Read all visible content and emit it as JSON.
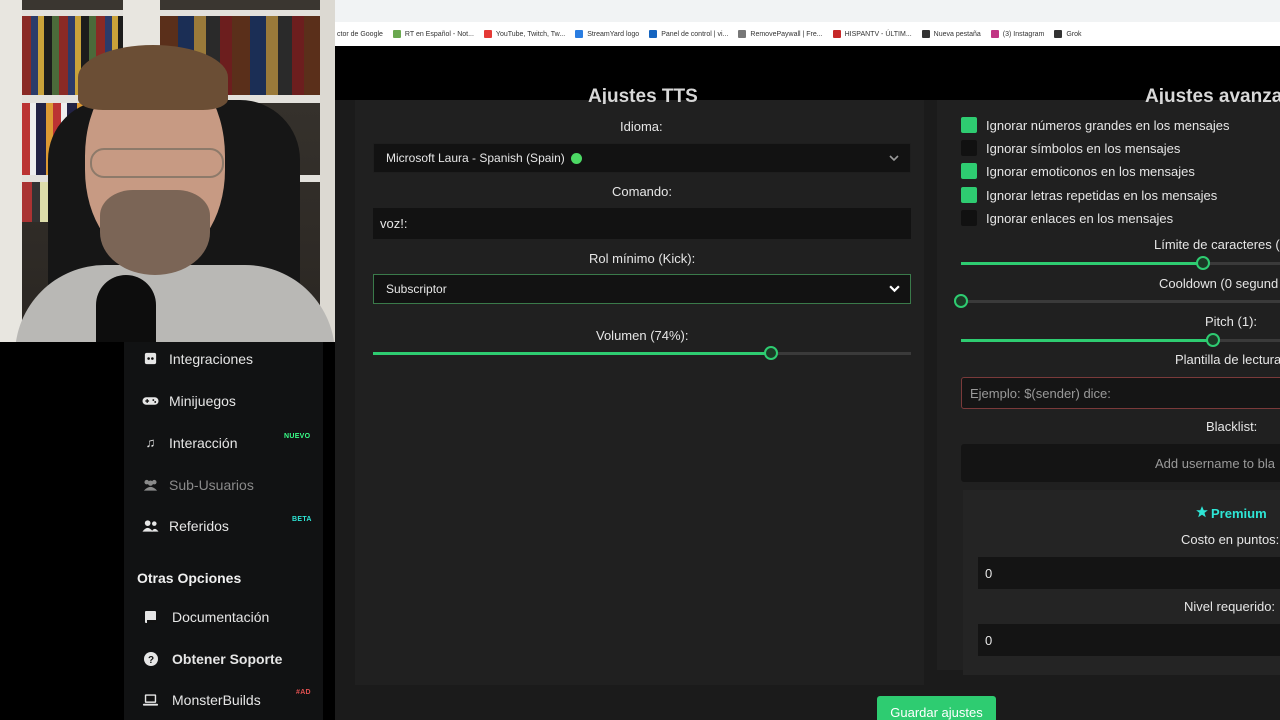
{
  "browser": {
    "bookmarks": [
      {
        "label": "ctor de Google",
        "icon": "none",
        "color": "#ffffff"
      },
      {
        "label": "RT en Español - Not...",
        "icon": "rt-icon",
        "color": "#6aa84f"
      },
      {
        "label": "YouTube, Twitch, Tw...",
        "icon": "youtube-icon",
        "color": "#e53935"
      },
      {
        "label": "StreamYard logo",
        "icon": "streamyard-icon",
        "color": "#2a7de1"
      },
      {
        "label": "Panel de control | vi...",
        "icon": "panel-icon",
        "color": "#1565c0"
      },
      {
        "label": "RemovePaywall | Fre...",
        "icon": "diamond-icon",
        "color": "#777777"
      },
      {
        "label": "HISPANTV - ÚLTIM...",
        "icon": "hispantv-icon",
        "color": "#c62828"
      },
      {
        "label": "Nueva pestaña",
        "icon": "globe-icon",
        "color": "#333333"
      },
      {
        "label": "(3) Instagram",
        "icon": "instagram-icon",
        "color": "#c13584"
      },
      {
        "label": "Grok",
        "icon": "grok-icon",
        "color": "#333333"
      }
    ]
  },
  "sidebar": {
    "items": [
      {
        "label": "Integraciones",
        "icon": "discord-icon",
        "badge": ""
      },
      {
        "label": "Minijuegos",
        "icon": "gamepad-icon",
        "badge": ""
      },
      {
        "label": "Interacción",
        "icon": "music-note-icon",
        "badge": "NUEVO"
      },
      {
        "label": "Sub-Usuarios",
        "icon": "users-icon",
        "badge": ""
      },
      {
        "label": "Referidos",
        "icon": "user-group-icon",
        "badge": "BETA"
      }
    ],
    "section_title": "Otras Opciones",
    "other_items": [
      {
        "label": "Documentación",
        "icon": "book-icon",
        "badge": ""
      },
      {
        "label": "Obtener Soporte",
        "icon": "question-icon",
        "badge": ""
      },
      {
        "label": "MonsterBuilds",
        "icon": "laptop-icon",
        "badge": "#AD"
      }
    ],
    "badge_colors": {
      "NUEVO": "#39ff88",
      "BETA": "#2ee6d6",
      "#AD": "#e05050"
    }
  },
  "tts_settings": {
    "title": "Ajustes TTS",
    "language_label": "Idioma:",
    "language_value": "Microsoft Laura - Spanish (Spain)",
    "command_label": "Comando:",
    "command_value": "voz!:",
    "min_role_label": "Rol mínimo (Kick):",
    "min_role_value": "Subscriptor",
    "volume_label": "Volumen (74%):",
    "volume_fraction": 0.74
  },
  "advanced_settings": {
    "title": "Ajustes avanzados",
    "checks": [
      {
        "label": "Ignorar números grandes en los mensajes",
        "checked": true
      },
      {
        "label": "Ignorar símbolos en los mensajes",
        "checked": false
      },
      {
        "label": "Ignorar emoticonos en los mensajes",
        "checked": true
      },
      {
        "label": "Ignorar letras repetidas en los mensajes",
        "checked": true
      },
      {
        "label": "Ignorar enlaces en los mensajes",
        "checked": false
      }
    ],
    "char_limit_label": "Límite de caracteres (",
    "char_limit_fraction": 0.76,
    "cooldown_label": "Cooldown (0 segund",
    "cooldown_fraction": 0.0,
    "pitch_label": "Pitch (1):",
    "pitch_fraction": 0.79,
    "template_label": "Plantilla de lectura",
    "template_placeholder": "Ejemplo: $(sender) dice:",
    "blacklist_label": "Blacklist:",
    "blacklist_placeholder": "Add username to bla",
    "premium_label": "Premium",
    "cost_label": "Costo en puntos:",
    "cost_value": "0",
    "level_label": "Nivel requerido:",
    "level_value": "0"
  },
  "save_button": "Guardar ajustes",
  "colors": {
    "accent": "#2ecc71",
    "premium": "#2ee6d6"
  }
}
